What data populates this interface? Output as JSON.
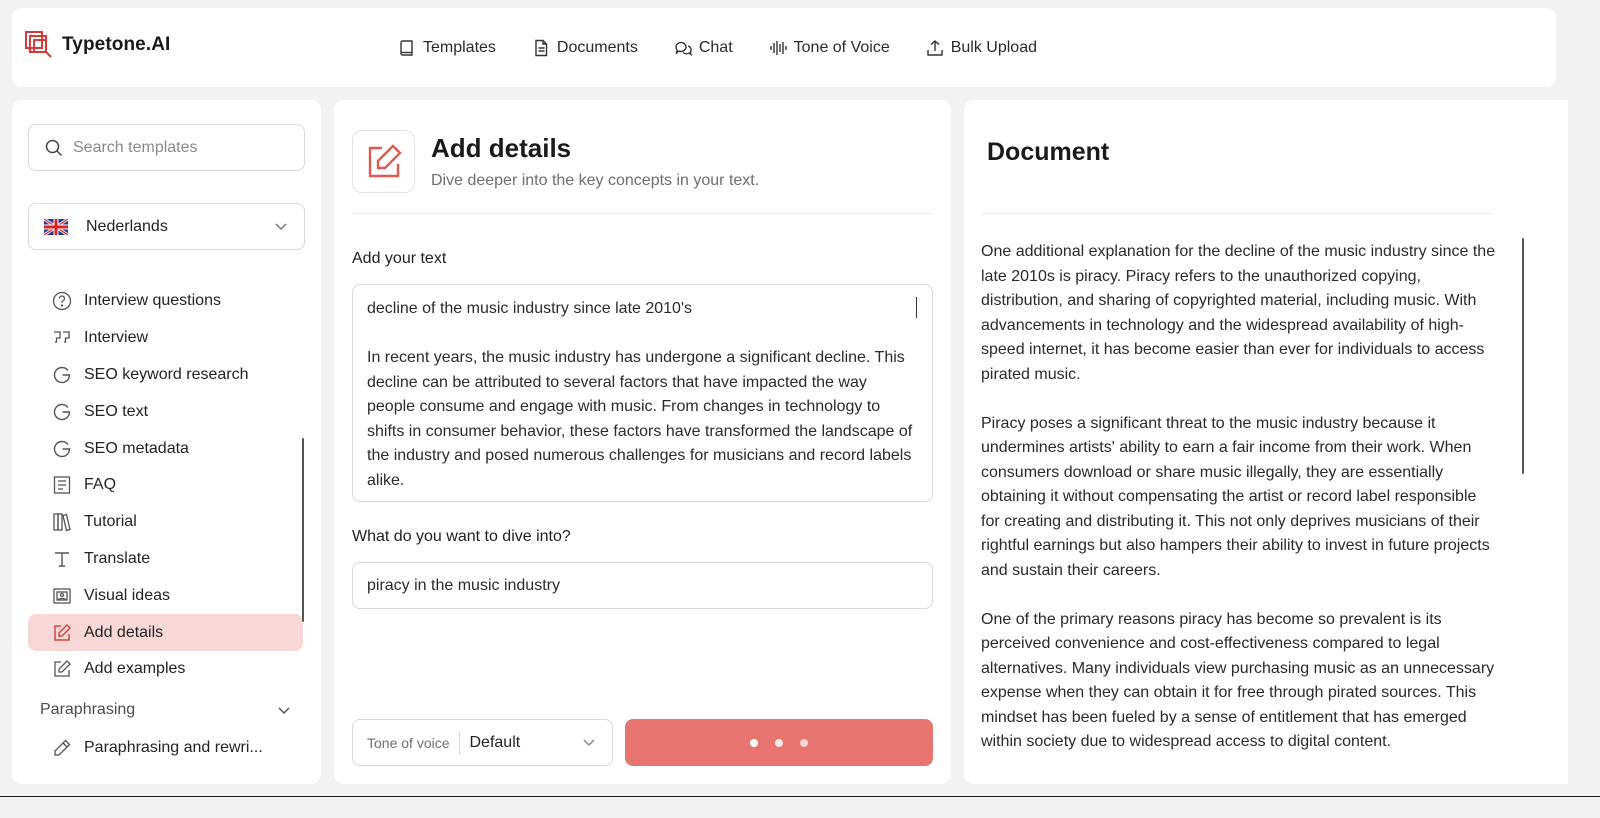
{
  "app": {
    "name": "Typetone.AI",
    "accent": "#e8746f"
  },
  "nav": [
    {
      "label": "Templates",
      "icon": "book-icon"
    },
    {
      "label": "Documents",
      "icon": "document-icon"
    },
    {
      "label": "Chat",
      "icon": "chat-icon"
    },
    {
      "label": "Tone of Voice",
      "icon": "soundwave-icon"
    },
    {
      "label": "Bulk Upload",
      "icon": "upload-icon"
    }
  ],
  "sidebar": {
    "search_placeholder": "Search templates",
    "language": "Nederlands",
    "items": [
      {
        "label": "Interview questions",
        "icon": "question-circle-icon"
      },
      {
        "label": "Interview",
        "icon": "quote-icon"
      },
      {
        "label": "SEO keyword research",
        "icon": "google-g-icon"
      },
      {
        "label": "SEO text",
        "icon": "google-g-icon"
      },
      {
        "label": "SEO metadata",
        "icon": "google-g-icon"
      },
      {
        "label": "FAQ",
        "icon": "list-doc-icon"
      },
      {
        "label": "Tutorial",
        "icon": "books-icon"
      },
      {
        "label": "Translate",
        "icon": "text-t-icon"
      },
      {
        "label": "Visual ideas",
        "icon": "image-icon"
      },
      {
        "label": "Add details",
        "icon": "edit-icon",
        "active": true
      },
      {
        "label": "Add examples",
        "icon": "edit-icon"
      }
    ],
    "section": {
      "label": "Paraphrasing"
    },
    "section_items": [
      {
        "label": "Paraphrasing and rewri...",
        "icon": "pencil-icon"
      }
    ]
  },
  "panel": {
    "title": "Add details",
    "subtitle": "Dive deeper into the key concepts in your text.",
    "text_label": "Add your text",
    "text_value": [
      "decline of the music industry since late 2010's",
      "In recent years, the music industry has undergone a significant decline. This decline can be attributed to several factors that have impacted the way people consume and engage with music. From changes in technology to shifts in consumer behavior, these factors have transformed the landscape of the industry and posed numerous challenges for musicians and record labels alike."
    ],
    "dive_label": "What do you want to dive into?",
    "dive_value": "piracy in the music industry",
    "tone_label": "Tone of voice",
    "tone_value": "Default"
  },
  "document": {
    "title": "Document",
    "paragraphs": [
      "One additional explanation for the decline of the music industry since the late 2010s is piracy. Piracy refers to the unauthorized copying, distribution, and sharing of copyrighted material, including music. With advancements in technology and the widespread availability of high-speed internet, it has become easier than ever for individuals to access pirated music.",
      "Piracy poses a significant threat to the music industry because it undermines artists' ability to earn a fair income from their work. When consumers download or share music illegally, they are essentially obtaining it without compensating the artist or record label responsible for creating and distributing it. This not only deprives musicians of their rightful earnings but also hampers their ability to invest in future projects and sustain their careers.",
      "One of the primary reasons piracy has become so prevalent is its perceived convenience and cost-effectiveness compared to legal alternatives. Many individuals view purchasing music as an unnecessary expense when they can obtain it for free through pirated sources. This mindset has been fueled by a sense of entitlement that has emerged within society due to widespread access to digital content."
    ]
  }
}
